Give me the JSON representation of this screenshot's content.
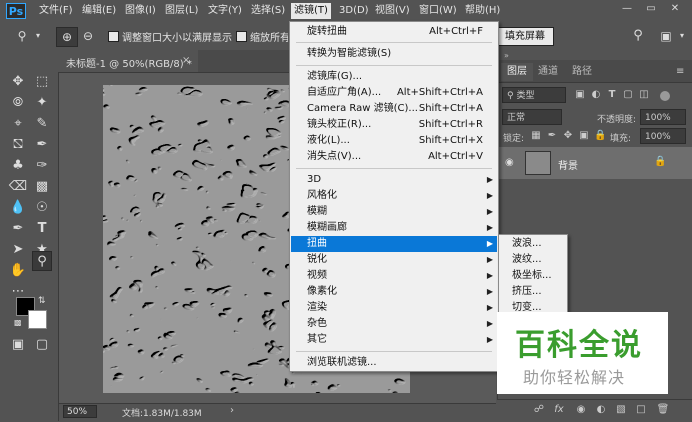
{
  "app": {
    "logo": "Ps"
  },
  "menubar": [
    {
      "label": "文件(F)"
    },
    {
      "label": "编辑(E)"
    },
    {
      "label": "图像(I)"
    },
    {
      "label": "图层(L)"
    },
    {
      "label": "文字(Y)"
    },
    {
      "label": "选择(S)"
    },
    {
      "label": "滤镜(T)"
    },
    {
      "label": "3D(D)"
    },
    {
      "label": "视图(V)"
    },
    {
      "label": "窗口(W)"
    },
    {
      "label": "帮助(H)"
    }
  ],
  "window_buttons": {
    "minimize": "—",
    "restore": "▭",
    "close": "✕"
  },
  "options_bar": {
    "resize_windows_label": "调整窗口大小以满屏显示",
    "zoom_all_label": "缩放所有窗口",
    "fill_screen_button": "填充屏幕"
  },
  "document": {
    "tab_title": "未标题-1 @ 50%(RGB/8) *",
    "close": "×",
    "zoom": "50%",
    "info": "文档:1.83M/1.83M",
    "arrow": "›"
  },
  "filter_menu": {
    "items": [
      {
        "label": "旋转扭曲",
        "shortcut": "Alt+Ctrl+F"
      },
      {
        "sep": true
      },
      {
        "label": "转换为智能滤镜(S)"
      },
      {
        "sep": true
      },
      {
        "label": "滤镜库(G)..."
      },
      {
        "label": "自适应广角(A)...",
        "shortcut": "Alt+Shift+Ctrl+A"
      },
      {
        "label": "Camera Raw 滤镜(C)...",
        "shortcut": "Shift+Ctrl+A"
      },
      {
        "label": "镜头校正(R)...",
        "shortcut": "Shift+Ctrl+R"
      },
      {
        "label": "液化(L)...",
        "shortcut": "Shift+Ctrl+X"
      },
      {
        "label": "消失点(V)...",
        "shortcut": "Alt+Ctrl+V"
      },
      {
        "sep": true
      },
      {
        "label": "3D",
        "submenu": true
      },
      {
        "label": "风格化",
        "submenu": true
      },
      {
        "label": "模糊",
        "submenu": true
      },
      {
        "label": "模糊画廊",
        "submenu": true
      },
      {
        "label": "扭曲",
        "submenu": true,
        "highlighted": true
      },
      {
        "label": "锐化",
        "submenu": true
      },
      {
        "label": "视频",
        "submenu": true
      },
      {
        "label": "像素化",
        "submenu": true
      },
      {
        "label": "渲染",
        "submenu": true
      },
      {
        "label": "杂色",
        "submenu": true
      },
      {
        "label": "其它",
        "submenu": true
      },
      {
        "sep": true
      },
      {
        "label": "浏览联机滤镜..."
      }
    ]
  },
  "distort_submenu": [
    {
      "label": "波浪..."
    },
    {
      "label": "波纹..."
    },
    {
      "label": "极坐标..."
    },
    {
      "label": "挤压..."
    },
    {
      "label": "切变..."
    }
  ],
  "layers_panel": {
    "tabs": [
      {
        "label": "图层"
      },
      {
        "label": "通道"
      },
      {
        "label": "路径"
      }
    ],
    "kind_filter": "类型",
    "blend_mode": "正常",
    "opacity_label": "不透明度:",
    "opacity_value": "100%",
    "lock_label": "锁定:",
    "fill_label": "填充:",
    "fill_value": "100%",
    "layer_name": "背景"
  },
  "watermark": {
    "title": "百科全说",
    "subtitle": "助你轻松解决"
  },
  "colors": {
    "highlight": "#0a78d7",
    "panel": "#535353",
    "watermark_green": "#3a9d2e"
  }
}
